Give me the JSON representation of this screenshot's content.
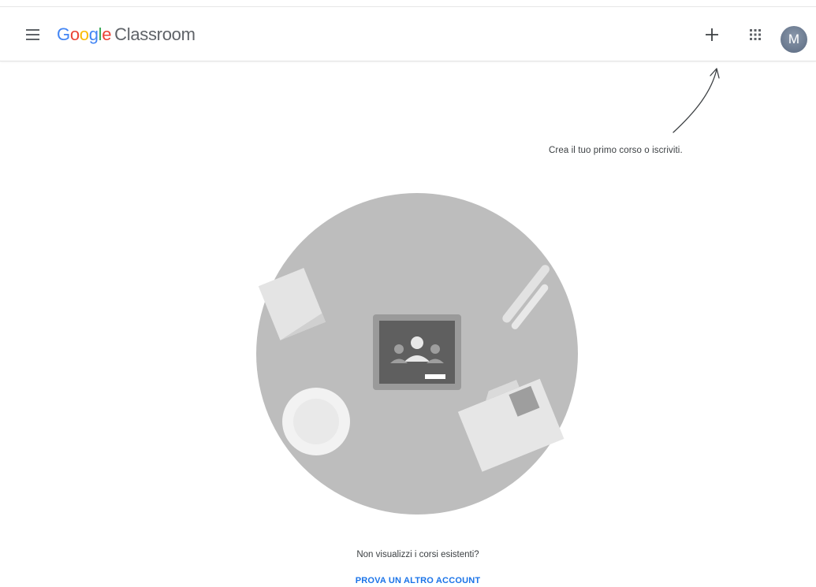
{
  "header": {
    "logo_google_letters": [
      "G",
      "o",
      "o",
      "g",
      "l",
      "e"
    ],
    "product_name": "Classroom",
    "avatar_initial": "M"
  },
  "icons": {
    "menu": "hamburger-menu-icon",
    "create": "plus-icon",
    "apps": "apps-grid-icon",
    "arrow": "curved-arrow-icon"
  },
  "hint_text": "Crea il tuo primo corso o iscriviti.",
  "footer": {
    "question": "Non visualizzi i corsi esistenti?",
    "link_label": "PROVA UN ALTRO ACCOUNT"
  },
  "colors": {
    "google_blue": "#4285F4",
    "google_red": "#EA4335",
    "google_yellow": "#FBBC05",
    "google_green": "#34A853",
    "link_blue": "#1a73e8",
    "illustration_gray": "#bdbdbd",
    "avatar": "#6b7b92"
  }
}
